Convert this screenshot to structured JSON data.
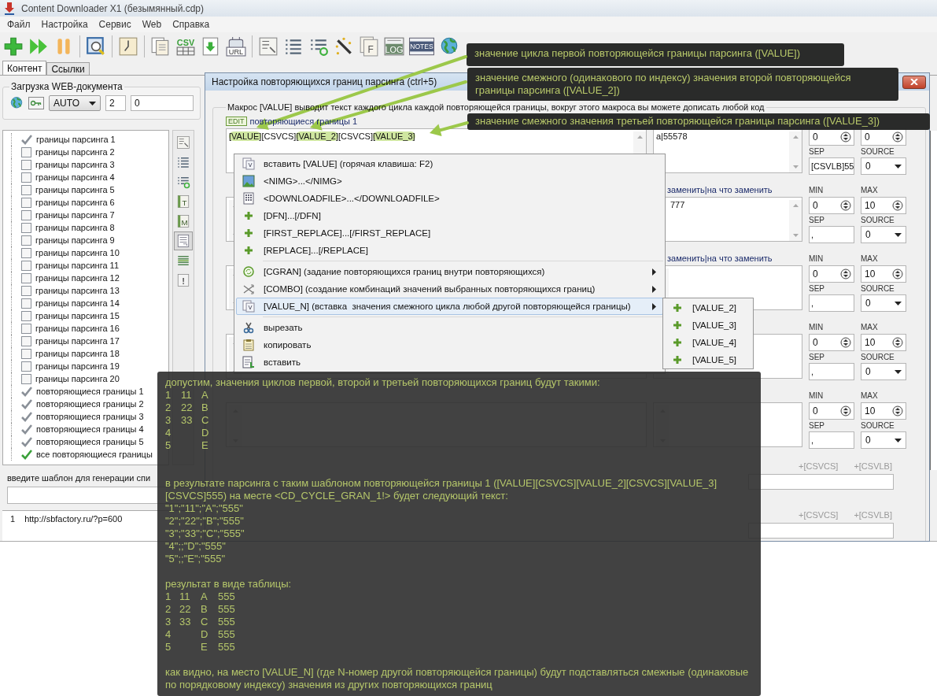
{
  "window": {
    "title": "Content Downloader X1 (безымянный.cdp)"
  },
  "menu": [
    "Файл",
    "Настройка",
    "Сервис",
    "Web",
    "Справка"
  ],
  "toolbar": [
    {
      "kind": "add"
    },
    {
      "kind": "play"
    },
    {
      "kind": "pause"
    },
    {
      "kind": "separator"
    },
    {
      "kind": "preview"
    },
    {
      "kind": "separator"
    },
    {
      "kind": "clock"
    },
    {
      "kind": "separator"
    },
    {
      "kind": "documents"
    },
    {
      "kind": "csv",
      "text": "CSV"
    },
    {
      "kind": "download"
    },
    {
      "kind": "robot",
      "text": "URL"
    },
    {
      "kind": "separator"
    },
    {
      "kind": "form"
    },
    {
      "kind": "list"
    },
    {
      "kind": "list-refresh"
    },
    {
      "kind": "wand"
    },
    {
      "kind": "letter-doc",
      "text": "F"
    },
    {
      "kind": "log",
      "text": "LOG"
    },
    {
      "kind": "notes",
      "text": "NOTES"
    },
    {
      "kind": "globe"
    }
  ],
  "tabs": [
    {
      "label": "Контент",
      "selected": true
    },
    {
      "label": "Ссылки",
      "selected": false
    }
  ],
  "load_group": {
    "title": "Загрузка WEB-документа",
    "mode": "AUTO",
    "threads": "2",
    "delay": "0"
  },
  "tree": [
    {
      "label": "границы парсинга 1",
      "kind": "item",
      "checked": true
    },
    {
      "label": "границы парсинга 2",
      "kind": "item",
      "checked": false
    },
    {
      "label": "границы парсинга 3",
      "kind": "item",
      "checked": false
    },
    {
      "label": "границы парсинга 4",
      "kind": "item",
      "checked": false
    },
    {
      "label": "границы парсинга 5",
      "kind": "item",
      "checked": false
    },
    {
      "label": "границы парсинга 6",
      "kind": "item",
      "checked": false
    },
    {
      "label": "границы парсинга 7",
      "kind": "item",
      "checked": false
    },
    {
      "label": "границы парсинга 8",
      "kind": "item",
      "checked": false
    },
    {
      "label": "границы парсинга 9",
      "kind": "item",
      "checked": false
    },
    {
      "label": "границы парсинга 10",
      "kind": "item",
      "checked": false
    },
    {
      "label": "границы парсинга 11",
      "kind": "item",
      "checked": false
    },
    {
      "label": "границы парсинга 12",
      "kind": "item",
      "checked": false
    },
    {
      "label": "границы парсинга 13",
      "kind": "item",
      "checked": false
    },
    {
      "label": "границы парсинга 14",
      "kind": "item",
      "checked": false
    },
    {
      "label": "границы парсинга 15",
      "kind": "item",
      "checked": false
    },
    {
      "label": "границы парсинга 16",
      "kind": "item",
      "checked": false
    },
    {
      "label": "границы парсинга 17",
      "kind": "item",
      "checked": false
    },
    {
      "label": "границы парсинга 18",
      "kind": "item",
      "checked": false
    },
    {
      "label": "границы парсинга 19",
      "kind": "item",
      "checked": false
    },
    {
      "label": "границы парсинга 20",
      "kind": "item",
      "checked": false
    },
    {
      "label": "повторяющиеся границы 1",
      "kind": "item",
      "checked": true
    },
    {
      "label": "повторяющиеся границы 2",
      "kind": "item",
      "checked": true
    },
    {
      "label": "повторяющиеся границы 3",
      "kind": "item",
      "checked": true
    },
    {
      "label": "повторяющиеся границы 4",
      "kind": "item",
      "checked": true
    },
    {
      "label": "повторяющиеся границы 5",
      "kind": "item",
      "checked": true
    },
    {
      "label": "все повторяющиеся границы",
      "kind": "all",
      "checked": true
    }
  ],
  "side_tools": [
    {
      "kind": "form",
      "selected": false
    },
    {
      "kind": "list",
      "selected": false
    },
    {
      "kind": "list-refresh",
      "selected": false
    },
    {
      "kind": "letter",
      "text": "T",
      "selected": false
    },
    {
      "kind": "letter",
      "text": "M",
      "selected": false
    },
    {
      "kind": "doc-list",
      "selected": true
    },
    {
      "kind": "lines",
      "selected": false
    },
    {
      "kind": "alert",
      "text": "!",
      "selected": false
    }
  ],
  "pattern_label": "введите шаблон для генерации спи",
  "urls": [
    {
      "number": "1",
      "url": "http://sbfactory.ru/?p=600"
    }
  ],
  "dialog": {
    "title": "Настройка повторяющихся границ парсинга (ctrl+5)",
    "macro_hint": "Макрос [VALUE] выводит текст каждого цикла каждой повторяющейся границы, вокруг этого макроса вы можете дописать любой код",
    "sections": [
      {
        "badge": "EDIT",
        "title": "повторяющиеся границы 1",
        "template": [
          {
            "text": "[VALUE]",
            "highlighted": true
          },
          {
            "text": "[CSVCS]",
            "highlighted": false
          },
          {
            "text": "[VALUE_2]",
            "highlighted": true
          },
          {
            "text": "[CSVCS]",
            "highlighted": false
          },
          {
            "text": "[VALUE_3]",
            "highlighted": true
          }
        ],
        "replace_value": "a|55578",
        "min": "0",
        "max": "0",
        "sep_label": "SEP",
        "source_label": "SOURCE",
        "sep": "[CSVLB]55",
        "source": "0"
      },
      {
        "replace_header": "заменить|на что заменить",
        "replace_value": "777",
        "min_label": "MIN",
        "max_label": "MAX",
        "min": "0",
        "max": "10",
        "sep_label": "SEP",
        "source_label": "SOURCE",
        "sep": ",",
        "source": "0"
      },
      {
        "replace_header": "заменить|на что заменить",
        "min_label": "MIN",
        "max_label": "MAX",
        "min": "0",
        "max": "10",
        "sep_label": "SEP",
        "source_label": "SOURCE",
        "sep": ",",
        "source": "0"
      },
      {
        "min_label": "MIN",
        "max_label": "MAX",
        "min": "0",
        "max": "10",
        "sep_label": "SEP",
        "source_label": "SOURCE",
        "sep": ",",
        "source": "0"
      },
      {
        "min_label": "MIN",
        "max_label": "MAX",
        "min": "0",
        "max": "10",
        "sep_label": "SEP",
        "source_label": "SOURCE",
        "sep": ",",
        "source": "0"
      }
    ],
    "output_rows": [
      {
        "buttons": [
          "+[CSVCS]",
          "+[CSVLB]"
        ]
      },
      {
        "buttons": [
          "+[CSVCS]",
          "+[CSVLB]"
        ]
      }
    ]
  },
  "context_menu": [
    {
      "kind": "value-doc",
      "label": "вставить [VALUE] (горячая клавиша: F2)",
      "submenu": false,
      "selected": false
    },
    {
      "kind": "image",
      "label": "<NIMG>...</NIMG>",
      "submenu": false,
      "selected": false
    },
    {
      "kind": "grid",
      "label": "<DOWNLOADFILE>...</DOWNLOADFILE>",
      "submenu": false,
      "selected": false
    },
    {
      "kind": "plus",
      "label": "[DFN]...[/DFN]",
      "submenu": false,
      "selected": false
    },
    {
      "kind": "plus",
      "label": "[FIRST_REPLACE]...[/FIRST_REPLACE]",
      "submenu": false,
      "selected": false
    },
    {
      "kind": "plus",
      "label": "[REPLACE]...[/REPLACE]",
      "submenu": false,
      "selected": false
    },
    {
      "kind": "separator"
    },
    {
      "kind": "cycle",
      "label": "[CGRAN] (задание повторяющихся границ внутри повторяющихся)",
      "submenu": true,
      "selected": false
    },
    {
      "kind": "shuffle",
      "label": "[COMBO] (создание комбинаций значений выбранных повторяющихся границ)",
      "submenu": true,
      "selected": false
    },
    {
      "kind": "value-doc",
      "label": "[VALUE_N] (вставка  значения смежного цикла любой другой повторяющейся границы)",
      "submenu": true,
      "selected": true
    },
    {
      "kind": "separator"
    },
    {
      "kind": "scissors",
      "label": "вырезать",
      "submenu": false,
      "selected": false
    },
    {
      "kind": "clipboard",
      "label": "копировать",
      "submenu": false,
      "selected": false
    },
    {
      "kind": "paste",
      "label": "вставить",
      "submenu": false,
      "selected": false
    }
  ],
  "submenu": [
    {
      "label": "[VALUE_2]",
      "selected": false
    },
    {
      "label": "[VALUE_3]",
      "selected": false
    },
    {
      "label": "[VALUE_4]",
      "selected": false
    },
    {
      "label": "[VALUE_5]",
      "selected": false
    }
  ],
  "callouts": [
    {
      "text": "значение цикла первой повторяющейся границы парсинга ([VALUE])"
    },
    {
      "text": "значение смежного (одинакового по индексу) значения второй повторяющейся границы парсинга ([VALUE_2])"
    },
    {
      "text": "значение смежного значения третьей повторяющейся границы парсинга ([VALUE_3])"
    }
  ],
  "note": {
    "intro": "допустим, значения циклов первой, второй и третьей повторяющихся границ будут такими:",
    "values_table": [
      {
        "col_1": "1",
        "col_2": "11",
        "col_3": "A"
      },
      {
        "col_1": "2",
        "col_2": "22",
        "col_3": "B"
      },
      {
        "col_1": "3",
        "col_2": "33",
        "col_3": "C"
      },
      {
        "col_1": "4",
        "col_3": "D"
      },
      {
        "col_1": "5",
        "col_3": "E"
      }
    ],
    "result_intro": "в результате парсинга с таким шаблоном повторяющейся границы 1 ([VALUE][CSVCS][VALUE_2][CSVCS][VALUE_3][CSVCS]555) на месте <CD_CYCLE_GRAN_1!> будет следующий текст:",
    "result_lines": [
      "\"1\";\"11\";\"A\";\"555\"",
      "\"2\";\"22\";\"B\";\"555\"",
      "\"3\";\"33\";\"C\";\"555\"",
      "\"4\";;\"D\";\"555\"",
      "\"5\";;\"E\";\"555\""
    ],
    "table_intro": "результат в виде таблицы:",
    "result_table": [
      {
        "col_1": "1",
        "col_2": "11",
        "col_3": "A",
        "col_4": "555"
      },
      {
        "col_1": "2",
        "col_2": "22",
        "col_3": "B",
        "col_4": "555"
      },
      {
        "col_1": "3",
        "col_2": "33",
        "col_3": "C",
        "col_4": "555"
      },
      {
        "col_1": "4",
        "col_3": "D",
        "col_4": "555"
      },
      {
        "col_1": "5",
        "col_3": "E",
        "col_4": "555"
      }
    ],
    "conclusion": "как видно, на место [VALUE_N] (где N-номер другой повторяющейся границы) будут подставляться смежные (одинаковые по порядковому индексу) значения из других повторяющихся границ"
  }
}
